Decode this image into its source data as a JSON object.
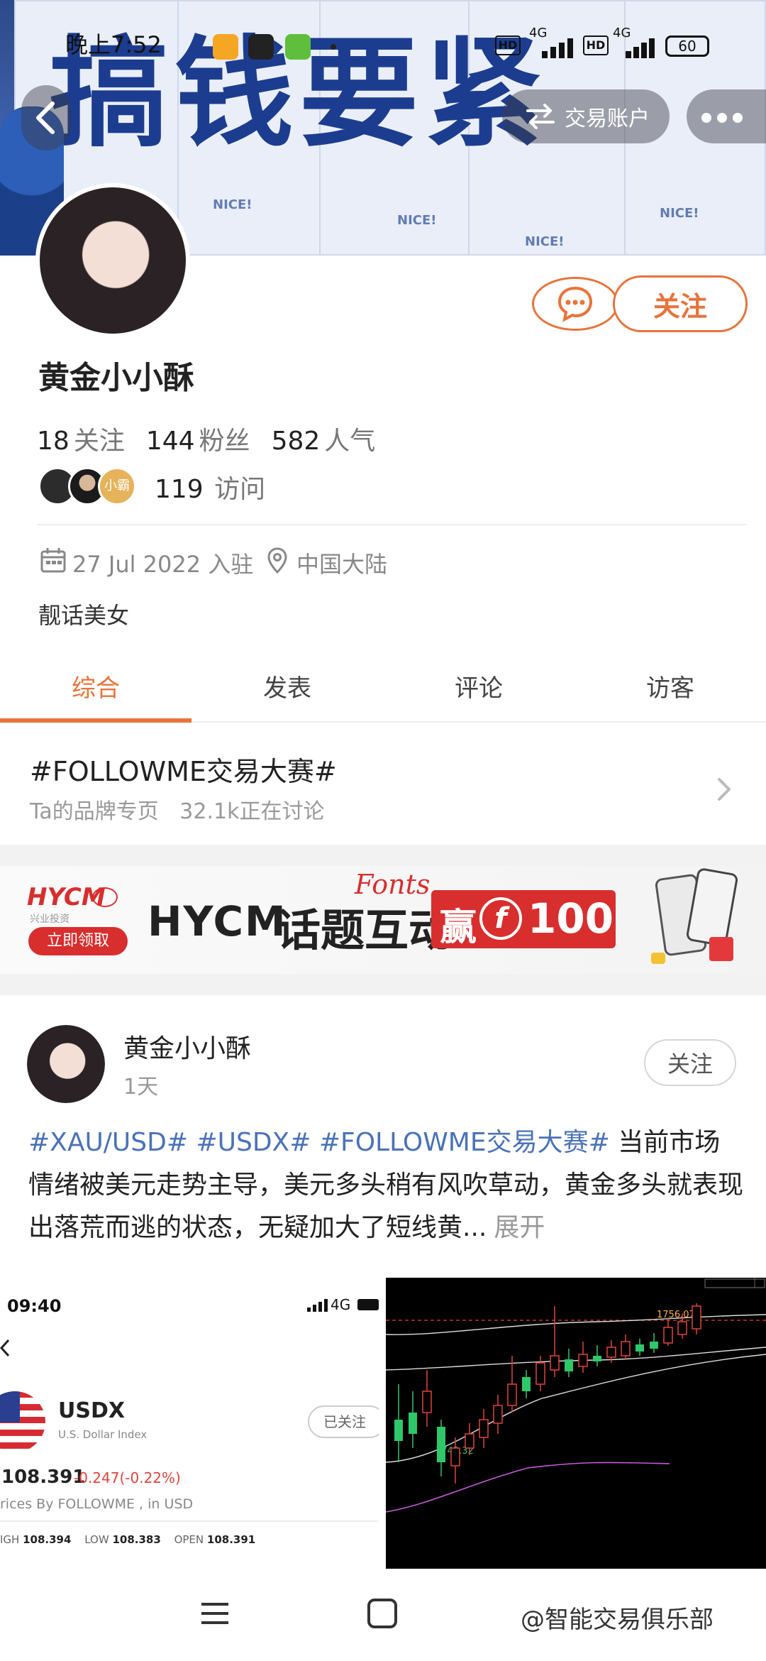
{
  "status_bar": {
    "time": "晚上7:52",
    "network_1": "4G",
    "network_2": "4G",
    "battery": "60"
  },
  "header": {
    "back_icon": "chevron-left-icon",
    "account_button": "交易账户",
    "more_icon": "more-icon"
  },
  "banner": {
    "headline": "搞钱要紧",
    "poster_text": "NICE!"
  },
  "profile": {
    "name": "黄金小小酥",
    "follow_button": "关注",
    "message_icon": "chat-bubble-icon",
    "stats": [
      {
        "value": "18",
        "label": "关注"
      },
      {
        "value": "144",
        "label": "粉丝"
      },
      {
        "value": "582",
        "label": "人气"
      }
    ],
    "visitor_badge": "小霸",
    "visits_value": "119",
    "visits_label": "访问",
    "joined": "27 Jul 2022 入驻",
    "location": "中国大陆",
    "bio": "靓话美女"
  },
  "tabs": [
    {
      "label": "综合",
      "active": true
    },
    {
      "label": "发表",
      "active": false
    },
    {
      "label": "评论",
      "active": false
    },
    {
      "label": "访客",
      "active": false
    }
  ],
  "topic": {
    "title": "#FOLLOWME交易大赛#",
    "subtitle_1": "Ta的品牌专页",
    "subtitle_2": "32.1k正在讨论"
  },
  "ad": {
    "brand": "HYCM",
    "brand_small": "兴业投资",
    "claim": "立即领取",
    "headline_1": "HYCM",
    "headline_2": "话题互动",
    "script": "Fonts",
    "win": "赢",
    "amount": "100"
  },
  "post": {
    "author": "黄金小小酥",
    "time": "1天",
    "follow_button": "关注",
    "tags": "#XAU/USD# #USDX# #FOLLOWME交易大赛#",
    "text": " 当前市场情绪被美元走势主导，美元多头稍有风吹草动，黄金多头就表现出落荒而逃的状态，无疑加大了短线黄...",
    "expand": "展开",
    "image1": {
      "time": "09:40",
      "network": "4G",
      "symbol": "USDX",
      "symbol_name": "U.S. Dollar Index",
      "followed": "已关注",
      "price": "108.391",
      "change": "-0.247(-0.22%)",
      "source": "rices By FOLLOWME , in USD",
      "high_label": "IGH",
      "high": "108.394",
      "low_label": "LOW",
      "low": "108.383",
      "open_label": "OPEN",
      "open": "108.391"
    },
    "image2": {
      "high_label": "1756.07",
      "low_label": "1742.32"
    }
  },
  "nav": {
    "menu_icon": "menu-icon",
    "home_icon": "home-square-icon",
    "watermark": "@智能交易俱乐部"
  },
  "colors": {
    "accent": "#e8733a",
    "link": "#4a72b8",
    "up": "#2fc76a",
    "down": "#e0443c"
  }
}
